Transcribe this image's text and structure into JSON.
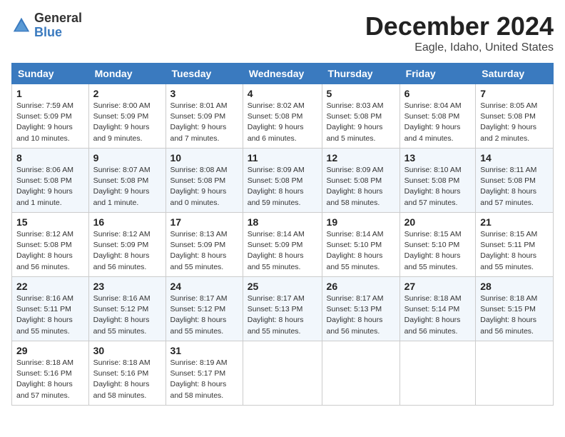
{
  "header": {
    "logo_general": "General",
    "logo_blue": "Blue",
    "month_title": "December 2024",
    "location": "Eagle, Idaho, United States"
  },
  "days_of_week": [
    "Sunday",
    "Monday",
    "Tuesday",
    "Wednesday",
    "Thursday",
    "Friday",
    "Saturday"
  ],
  "weeks": [
    [
      {
        "day": "1",
        "info": "Sunrise: 7:59 AM\nSunset: 5:09 PM\nDaylight: 9 hours and 10 minutes."
      },
      {
        "day": "2",
        "info": "Sunrise: 8:00 AM\nSunset: 5:09 PM\nDaylight: 9 hours and 9 minutes."
      },
      {
        "day": "3",
        "info": "Sunrise: 8:01 AM\nSunset: 5:09 PM\nDaylight: 9 hours and 7 minutes."
      },
      {
        "day": "4",
        "info": "Sunrise: 8:02 AM\nSunset: 5:08 PM\nDaylight: 9 hours and 6 minutes."
      },
      {
        "day": "5",
        "info": "Sunrise: 8:03 AM\nSunset: 5:08 PM\nDaylight: 9 hours and 5 minutes."
      },
      {
        "day": "6",
        "info": "Sunrise: 8:04 AM\nSunset: 5:08 PM\nDaylight: 9 hours and 4 minutes."
      },
      {
        "day": "7",
        "info": "Sunrise: 8:05 AM\nSunset: 5:08 PM\nDaylight: 9 hours and 2 minutes."
      }
    ],
    [
      {
        "day": "8",
        "info": "Sunrise: 8:06 AM\nSunset: 5:08 PM\nDaylight: 9 hours and 1 minute."
      },
      {
        "day": "9",
        "info": "Sunrise: 8:07 AM\nSunset: 5:08 PM\nDaylight: 9 hours and 1 minute."
      },
      {
        "day": "10",
        "info": "Sunrise: 8:08 AM\nSunset: 5:08 PM\nDaylight: 9 hours and 0 minutes."
      },
      {
        "day": "11",
        "info": "Sunrise: 8:09 AM\nSunset: 5:08 PM\nDaylight: 8 hours and 59 minutes."
      },
      {
        "day": "12",
        "info": "Sunrise: 8:09 AM\nSunset: 5:08 PM\nDaylight: 8 hours and 58 minutes."
      },
      {
        "day": "13",
        "info": "Sunrise: 8:10 AM\nSunset: 5:08 PM\nDaylight: 8 hours and 57 minutes."
      },
      {
        "day": "14",
        "info": "Sunrise: 8:11 AM\nSunset: 5:08 PM\nDaylight: 8 hours and 57 minutes."
      }
    ],
    [
      {
        "day": "15",
        "info": "Sunrise: 8:12 AM\nSunset: 5:08 PM\nDaylight: 8 hours and 56 minutes."
      },
      {
        "day": "16",
        "info": "Sunrise: 8:12 AM\nSunset: 5:09 PM\nDaylight: 8 hours and 56 minutes."
      },
      {
        "day": "17",
        "info": "Sunrise: 8:13 AM\nSunset: 5:09 PM\nDaylight: 8 hours and 55 minutes."
      },
      {
        "day": "18",
        "info": "Sunrise: 8:14 AM\nSunset: 5:09 PM\nDaylight: 8 hours and 55 minutes."
      },
      {
        "day": "19",
        "info": "Sunrise: 8:14 AM\nSunset: 5:10 PM\nDaylight: 8 hours and 55 minutes."
      },
      {
        "day": "20",
        "info": "Sunrise: 8:15 AM\nSunset: 5:10 PM\nDaylight: 8 hours and 55 minutes."
      },
      {
        "day": "21",
        "info": "Sunrise: 8:15 AM\nSunset: 5:11 PM\nDaylight: 8 hours and 55 minutes."
      }
    ],
    [
      {
        "day": "22",
        "info": "Sunrise: 8:16 AM\nSunset: 5:11 PM\nDaylight: 8 hours and 55 minutes."
      },
      {
        "day": "23",
        "info": "Sunrise: 8:16 AM\nSunset: 5:12 PM\nDaylight: 8 hours and 55 minutes."
      },
      {
        "day": "24",
        "info": "Sunrise: 8:17 AM\nSunset: 5:12 PM\nDaylight: 8 hours and 55 minutes."
      },
      {
        "day": "25",
        "info": "Sunrise: 8:17 AM\nSunset: 5:13 PM\nDaylight: 8 hours and 55 minutes."
      },
      {
        "day": "26",
        "info": "Sunrise: 8:17 AM\nSunset: 5:13 PM\nDaylight: 8 hours and 56 minutes."
      },
      {
        "day": "27",
        "info": "Sunrise: 8:18 AM\nSunset: 5:14 PM\nDaylight: 8 hours and 56 minutes."
      },
      {
        "day": "28",
        "info": "Sunrise: 8:18 AM\nSunset: 5:15 PM\nDaylight: 8 hours and 56 minutes."
      }
    ],
    [
      {
        "day": "29",
        "info": "Sunrise: 8:18 AM\nSunset: 5:16 PM\nDaylight: 8 hours and 57 minutes."
      },
      {
        "day": "30",
        "info": "Sunrise: 8:18 AM\nSunset: 5:16 PM\nDaylight: 8 hours and 58 minutes."
      },
      {
        "day": "31",
        "info": "Sunrise: 8:19 AM\nSunset: 5:17 PM\nDaylight: 8 hours and 58 minutes."
      },
      {
        "day": "",
        "info": ""
      },
      {
        "day": "",
        "info": ""
      },
      {
        "day": "",
        "info": ""
      },
      {
        "day": "",
        "info": ""
      }
    ]
  ]
}
